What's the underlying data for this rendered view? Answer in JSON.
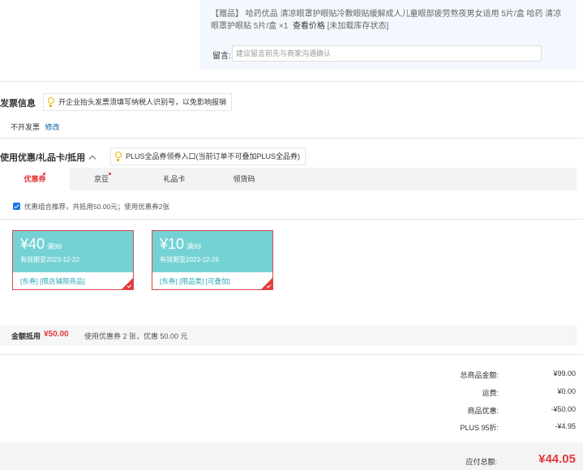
{
  "gift": {
    "tag": "【赠品】",
    "text": "哈药优品 清凉眼罩护眼贴冷敷眼贴缓解成人儿童眼部疲劳熬夜男女适用 5片/盒 哈药 清凉眼罩护眼贴 5片/盒 ×1",
    "check_price": "查看价格",
    "stock_status": "[未加载库存状态]"
  },
  "memo": {
    "label": "留言:",
    "placeholder": "建议留言前先与商家沟通确认"
  },
  "invoice": {
    "title": "发票信息",
    "tip": "开企业抬头发票须填写纳税人识别号，以免影响报销",
    "status": "不开发票",
    "edit": "修改"
  },
  "discount": {
    "title": "使用优惠/礼品卡/抵用",
    "tip": "PLUS全品券领券入口(当前订单不可叠加PLUS全品券)",
    "tabs": [
      {
        "label": "优惠券",
        "active": true,
        "dot": true
      },
      {
        "label": "京豆",
        "active": false,
        "dot": true
      },
      {
        "label": "礼品卡",
        "active": false,
        "dot": false
      },
      {
        "label": "领货码",
        "active": false,
        "dot": false
      }
    ],
    "combo_text": "优惠组合推荐，共抵用50.00元；使用优惠券2张",
    "coupons": [
      {
        "amount": "¥40",
        "condition": "满99",
        "expiry": "有效期至2023-12-22",
        "tags": "[东券] [限店铺限商品]"
      },
      {
        "amount": "¥10",
        "condition": "满99",
        "expiry": "有效期至2023-12-25",
        "tags": "[东券] [限品类] [可叠加]"
      }
    ],
    "deduct_label": "金额抵用",
    "deduct_amount": "¥50.00",
    "deduct_desc": "使用优惠券 2 张，优惠 50.00 元"
  },
  "summary": [
    {
      "label": "总商品金额:",
      "value": "¥99.00"
    },
    {
      "label": "运费:",
      "value": "¥0.00"
    },
    {
      "label": "商品优惠:",
      "value": "-¥50.00"
    },
    {
      "label": "PLUS 95折:",
      "value": "-¥4.95"
    }
  ],
  "payable": {
    "label": "应付总额:",
    "value": "¥44.05"
  },
  "colors": {
    "accent": "#e4393c",
    "coupon_bg": "#74d2d4",
    "link": "#005ea7",
    "tip_icon": "#f4b400"
  }
}
